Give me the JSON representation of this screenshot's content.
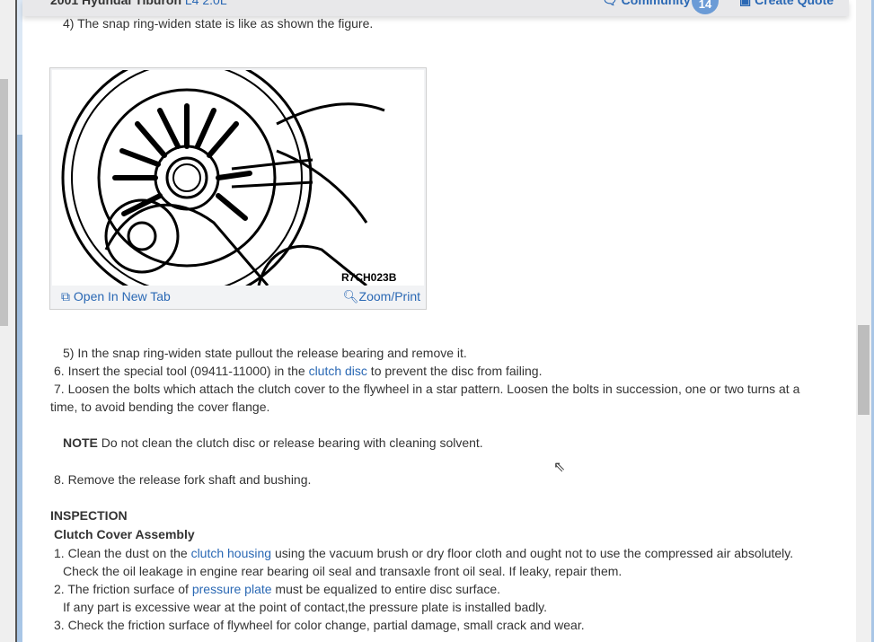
{
  "header": {
    "title_bold": "2001 Hyundai Tiburon",
    "title_engine": "L4 2.0L",
    "community_label": "Community",
    "community_count": "14",
    "create_quote_label": "Create Quote"
  },
  "content": {
    "step4": "4) The snap ring-widen state is like as shown the figure.",
    "figure": {
      "code": "R7CH023B",
      "open_label": "Open In New Tab",
      "zoom_label": "Zoom/Print"
    },
    "step5": "5) In the snap ring-widen state pullout the release bearing and remove it.",
    "step6_a": "6. Insert the special tool (09411-11000) in the ",
    "step6_link": "clutch disc",
    "step6_b": " to prevent the disc from failing.",
    "step7_l1": "7. Loosen the bolts which attach the clutch cover to the flywheel in a star pattern. Loosen the bolts in succession, one or two turns at a",
    "step7_l2": "time, to avoid bending the cover flange.",
    "note_label": "NOTE",
    "note_text": " Do not clean the clutch disc or release bearing with cleaning solvent.",
    "step8": "8. Remove the release fork shaft and bushing.",
    "inspection": "INSPECTION",
    "clutch_cover": "Clutch Cover Assembly",
    "i1_a": "1. Clean the dust on the ",
    "i1_link": "clutch housing",
    "i1_b": " using the vacuum brush or dry floor cloth and ought not to use the compressed air absolutely.",
    "i1_l2": "Check the oil leakage in engine rear bearing oil seal and transaxle front oil seal. If leaky, repair them.",
    "i2_a": "2. The friction surface of ",
    "i2_link": "pressure plate",
    "i2_b": " must be equalized to entire disc surface.",
    "i2_l2": "If any part is excessive wear at the point of contact,the pressure plate is installed badly.",
    "i3": "3. Check the friction surface of flywheel for color change, partial damage, small crack and wear."
  },
  "colors": {
    "link": "#2a68b4",
    "badge": "#6b9bd6"
  }
}
